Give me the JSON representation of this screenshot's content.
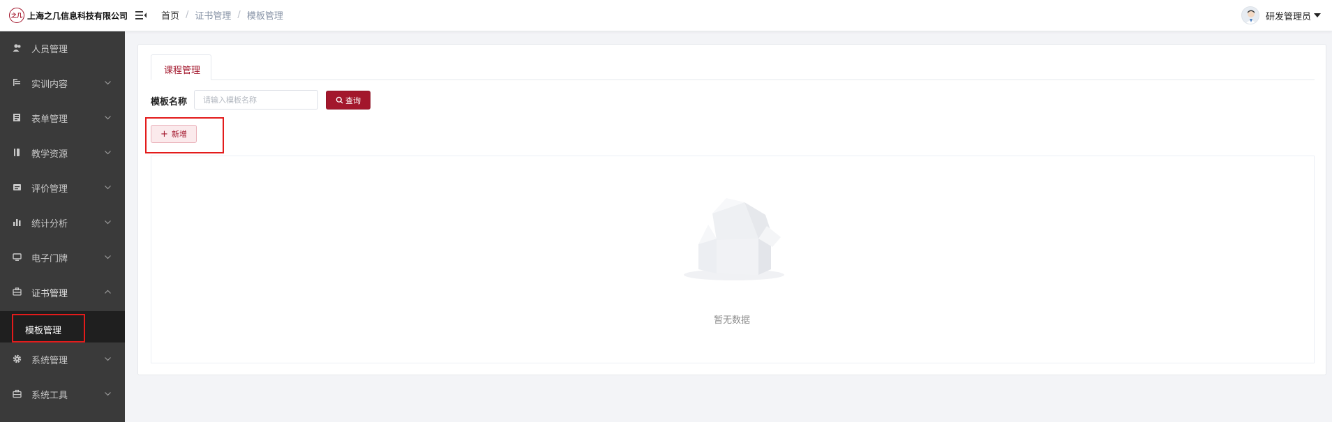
{
  "app": {
    "company_name": "上海之几信息科技有限公司",
    "logo_text": "之几",
    "brand_color": "#a3172c"
  },
  "header": {
    "collapse_icon": "menu-fold-icon",
    "breadcrumb": {
      "home": "首页",
      "separator": "/",
      "section": "证书管理",
      "current": "模板管理"
    },
    "user": {
      "name": "研发管理员",
      "avatar_icon": "user-avatar"
    }
  },
  "sidebar": {
    "items": [
      {
        "label": "人员管理",
        "icon": "user-icon"
      },
      {
        "label": "实训内容",
        "icon": "training-icon"
      },
      {
        "label": "表单管理",
        "icon": "form-icon"
      },
      {
        "label": "教学资源",
        "icon": "resource-icon"
      },
      {
        "label": "评价管理",
        "icon": "evaluation-icon"
      },
      {
        "label": "统计分析",
        "icon": "bar-chart-icon"
      },
      {
        "label": "电子门牌",
        "icon": "monitor-icon"
      },
      {
        "label": "证书管理",
        "icon": "certificate-icon",
        "expanded": true
      },
      {
        "label": "系统管理",
        "icon": "gear-icon"
      },
      {
        "label": "系统工具",
        "icon": "toolbox-icon"
      }
    ],
    "active_sub_item": "模板管理"
  },
  "main": {
    "tab_label": "课程管理",
    "search": {
      "label": "模板名称",
      "placeholder": "请输入模板名称",
      "value": "",
      "button_label": "查询"
    },
    "add_button_label": "新增",
    "add_button_symbol": "+",
    "empty_text": "暂无数据"
  }
}
